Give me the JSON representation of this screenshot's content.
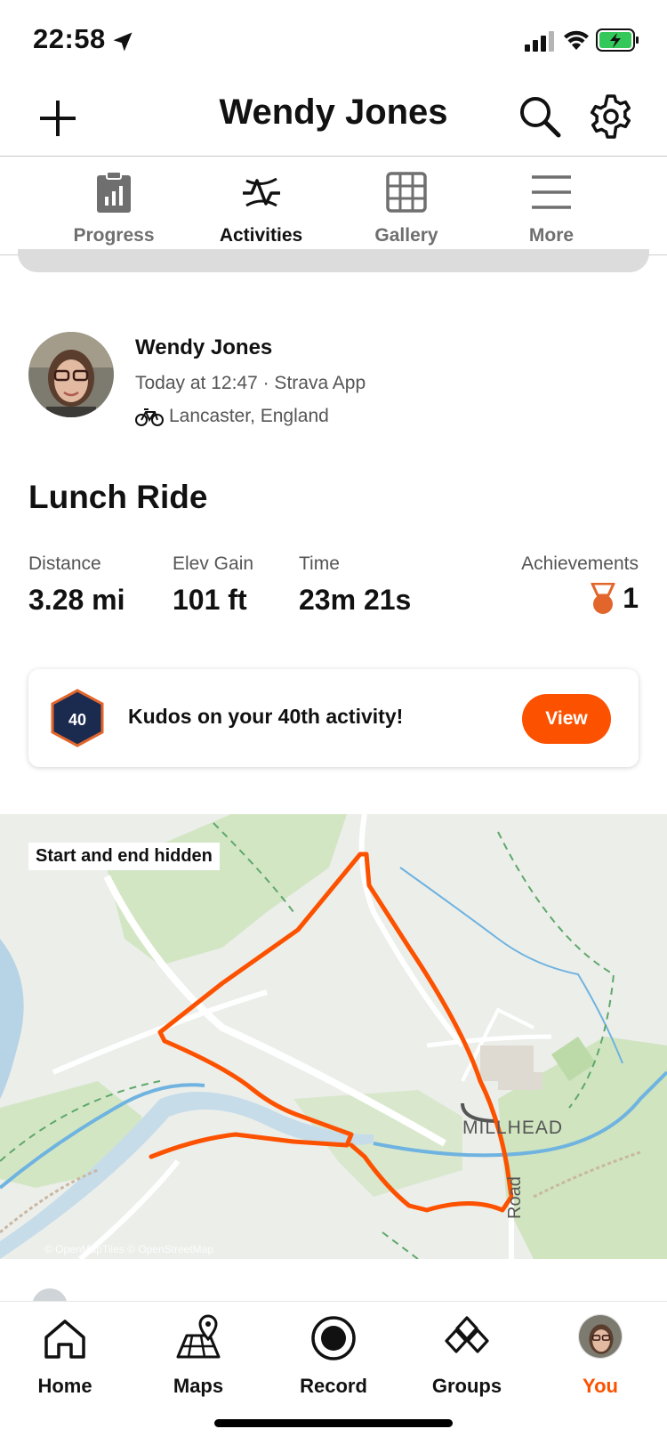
{
  "status_bar": {
    "time": "22:58"
  },
  "header": {
    "title": "Wendy Jones"
  },
  "tabs": [
    {
      "label": "Progress",
      "icon": "clipboard-chart-icon"
    },
    {
      "label": "Activities",
      "icon": "activity-pulse-icon",
      "active": true
    },
    {
      "label": "Gallery",
      "icon": "grid-icon"
    },
    {
      "label": "More",
      "icon": "menu-lines-icon"
    }
  ],
  "activity": {
    "athlete_name": "Wendy Jones",
    "meta": "Today at 12:47 · Strava App",
    "location": "Lancaster, England",
    "title": "Lunch Ride",
    "stats": [
      {
        "label": "Distance",
        "value": "3.28 mi"
      },
      {
        "label": "Elev Gain",
        "value": "101 ft"
      },
      {
        "label": "Time",
        "value": "23m 21s"
      }
    ],
    "achievements": {
      "label": "Achievements",
      "value": "1"
    }
  },
  "kudos": {
    "badge_number": "40",
    "text": "Kudos on your 40th activity!",
    "button": "View"
  },
  "map": {
    "tag": "Start and end hidden",
    "credit": "© OpenMapTiles © OpenStreetMap",
    "place_label": "MILLHEAD",
    "road_label": "Road"
  },
  "bottom_nav": [
    {
      "label": "Home",
      "icon": "home-icon"
    },
    {
      "label": "Maps",
      "icon": "map-pin-icon"
    },
    {
      "label": "Record",
      "icon": "record-icon"
    },
    {
      "label": "Groups",
      "icon": "groups-diamond-icon"
    },
    {
      "label": "You",
      "icon": "avatar",
      "active": true
    }
  ],
  "colors": {
    "accent": "#fc5200",
    "route": "#fc5200",
    "badge_blue": "#1b2a4f"
  }
}
